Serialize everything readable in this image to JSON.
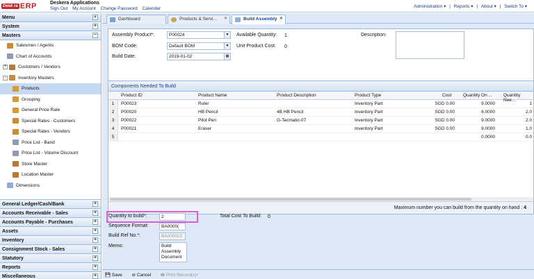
{
  "header": {
    "logo_badge": "Desk ra",
    "logo_text": "ERP",
    "app_name": "Deskera Applications",
    "links": [
      "Sign Out",
      "My Account",
      "Change Password",
      "Calendar"
    ],
    "right_menu": [
      "Administration ▾",
      "|",
      "Reports ▾",
      "|",
      "About ▾",
      "|",
      "Switch To ▾"
    ]
  },
  "sidebar": {
    "menu_label": "Menu",
    "system_label": "System",
    "masters_label": "Masters",
    "tree": [
      {
        "label": "Salesmen / Agents",
        "indent": 1,
        "icon_color": "#c98a3a"
      },
      {
        "label": "Chart of Accounts",
        "indent": 1,
        "icon_color": "#8f9bb0"
      },
      {
        "label": "Customers / Vendors",
        "indent": 0,
        "icon_color": "#b57a3a",
        "toggle": "+"
      },
      {
        "label": "Inventory Masters",
        "indent": 0,
        "icon_color": "#c98a3a",
        "toggle": "-"
      },
      {
        "label": "Products",
        "indent": 2,
        "icon_color": "#d69a3a",
        "selected": true
      },
      {
        "label": "Grouping",
        "indent": 2,
        "icon_color": "#d69a3a"
      },
      {
        "label": "General Price Rate",
        "indent": 2,
        "icon_color": "#d69a3a"
      },
      {
        "label": "Special Rates - Customers",
        "indent": 2,
        "icon_color": "#c98a3a"
      },
      {
        "label": "Special Rates - Vendors",
        "indent": 2,
        "icon_color": "#c98a3a"
      },
      {
        "label": "Price List - Band",
        "indent": 2,
        "icon_color": "#8f9bb0"
      },
      {
        "label": "Price List - Volume Discount",
        "indent": 2,
        "icon_color": "#8f9bb0"
      },
      {
        "label": "Store Master",
        "indent": 2,
        "icon_color": "#b57a3a"
      },
      {
        "label": "Location Master",
        "indent": 2,
        "icon_color": "#b57a3a"
      },
      {
        "label": "Dimensions",
        "indent": 1,
        "icon_color": "#8faed6"
      }
    ],
    "sections": [
      "General Ledger/Cash/Bank",
      "Accounts Receivable - Sales",
      "Accounts Payable - Purchases",
      "Assets",
      "Inventory",
      "Consignment Stock - Sales",
      "Statutory",
      "Reports",
      "Miscellaneous"
    ]
  },
  "tabs": [
    {
      "label": "Dashboard",
      "active": false
    },
    {
      "label": "Products & Servi...",
      "active": false
    },
    {
      "label": "Build Assembly",
      "active": true
    }
  ],
  "form": {
    "assembly_product_label": "Assembly Product*:",
    "assembly_product_value": "P00024",
    "bom_code_label": "BOM Code:",
    "bom_code_value": "Default BOM",
    "build_date_label": "Build Date:",
    "build_date_value": "2019-01-02",
    "available_qty_label": "Available Quantity:",
    "available_qty_value": "1",
    "unit_cost_label": "Unit Product Cost:",
    "unit_cost_value": "0",
    "description_label": "Description:",
    "description_value": ""
  },
  "grid": {
    "title": "Components Needed To Build",
    "columns": [
      "Product ID",
      "Product Name",
      "Product Description",
      "Product Type",
      "Cost",
      "Quantity On ...",
      "Quantity Nee..."
    ],
    "rows": [
      {
        "n": "1",
        "id": "P00023",
        "name": "Ruler",
        "desc": "",
        "type": "Inventory Part",
        "cost": "SGD 0.00",
        "qoh": "9.0000",
        "qneed": "1"
      },
      {
        "n": "2",
        "id": "P00020",
        "name": "HB Pencil",
        "desc": "4B HB Pencil",
        "type": "Inventory Part",
        "cost": "SGD 0.00",
        "qoh": "8.0000",
        "qneed": "2.0"
      },
      {
        "n": "3",
        "id": "P00022",
        "name": "Pilot Pen",
        "desc": "G-Tecmatic-07",
        "type": "Inventory Part",
        "cost": "SGD 0.00",
        "qoh": "9.0000",
        "qneed": "2.0"
      },
      {
        "n": "4",
        "id": "P00021",
        "name": "Eraser",
        "desc": "",
        "type": "Inventory Part",
        "cost": "SGD 0.00",
        "qoh": "9.0000",
        "qneed": "1.0"
      },
      {
        "n": "5",
        "id": "",
        "name": "",
        "desc": "",
        "type": "",
        "cost": "",
        "qoh": "0.0000",
        "qneed": "0.0"
      }
    ],
    "footer": "Maximum number you can build from the quantity on hand : ",
    "footer_value": "4"
  },
  "bottom": {
    "qty_label": "Quantity to build*:",
    "qty_value": "2",
    "total_cost_label": "Total Cost To Build:",
    "total_cost_value": "0",
    "seq_format_label": "Sequence Format:",
    "seq_format_value": "BA0000(",
    "build_ref_label": "Build Ref No.*:",
    "build_ref_value": "BA000002",
    "memo_label": "Memo:",
    "memo_value": "Build Assembly Document"
  },
  "buttons": {
    "save": "Save",
    "cancel": "Cancel",
    "print": "Print Record(s)▾"
  }
}
